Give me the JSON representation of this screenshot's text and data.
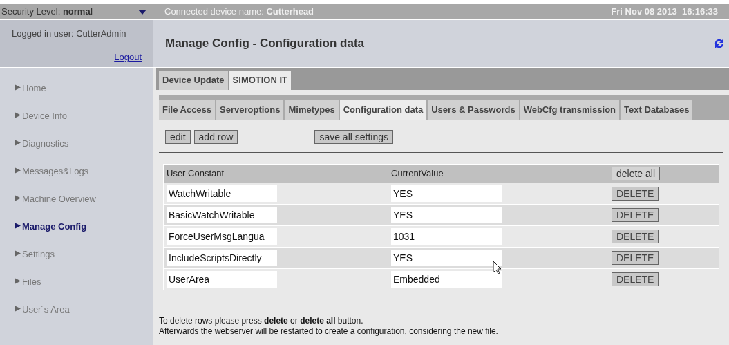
{
  "top_bar": {
    "security_label": "Security Level:",
    "security_value": "normal",
    "device_label": "Connected device name:",
    "device_value": "Cutterhead",
    "datetime": "Fri Nov 08 2013  16:16:33"
  },
  "user": {
    "logged_in": "Logged in user: CutterAdmin",
    "logout": "Logout"
  },
  "page_title": "Manage Config - Configuration data",
  "nav": [
    {
      "label": "Home",
      "selected": false
    },
    {
      "label": "Device Info",
      "selected": false
    },
    {
      "label": "Diagnostics",
      "selected": false
    },
    {
      "label": "Messages&Logs",
      "selected": false
    },
    {
      "label": "Machine Overview",
      "selected": false
    },
    {
      "label": "Manage Config",
      "selected": true
    },
    {
      "label": "Settings",
      "selected": false
    },
    {
      "label": "Files",
      "selected": false
    },
    {
      "label": "User´s Area",
      "selected": false
    }
  ],
  "tabs": [
    {
      "label": "Device Update",
      "selected": false
    },
    {
      "label": "SIMOTION IT",
      "selected": true
    }
  ],
  "subtabs": [
    {
      "label": "File Access",
      "selected": false
    },
    {
      "label": "Serveroptions",
      "selected": false
    },
    {
      "label": "Mimetypes",
      "selected": false
    },
    {
      "label": "Configuration data",
      "selected": true
    },
    {
      "label": "Users & Passwords",
      "selected": false
    },
    {
      "label": "WebCfg transmission",
      "selected": false
    },
    {
      "label": "Text Databases",
      "selected": false
    }
  ],
  "toolbar": [
    "edit",
    "add row"
  ],
  "save_button": "save all settings",
  "table": {
    "columns": [
      "User Constant",
      "CurrentValue"
    ],
    "delete_all": "delete all",
    "rows": [
      {
        "constant": "WatchWritable",
        "value": "YES",
        "delete": "DELETE"
      },
      {
        "constant": "BasicWatchWritable",
        "value": "YES",
        "delete": "DELETE"
      },
      {
        "constant": "ForceUserMsgLangua",
        "value": "1031",
        "delete": "DELETE"
      },
      {
        "constant": "IncludeScriptsDirectly",
        "value": "YES",
        "delete": "DELETE"
      },
      {
        "constant": "UserArea",
        "value": "Embedded",
        "delete": "DELETE"
      }
    ]
  },
  "notes": [
    "To delete rows please press **delete** or **delete all** button.",
    "Afterwards the webserver will be restarted to create a configuration, considering the new file."
  ]
}
